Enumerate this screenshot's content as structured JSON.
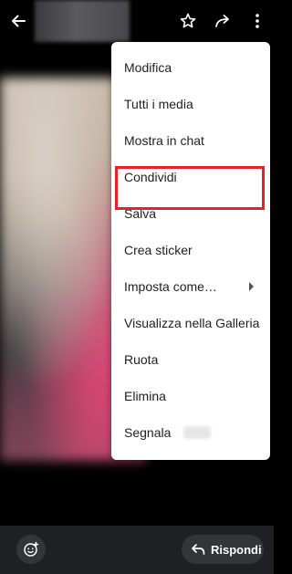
{
  "topbar": {
    "icons": {
      "back": "arrow-left",
      "star": "star-outline",
      "share": "forward-arrow",
      "more": "vertical-dots"
    }
  },
  "menu": {
    "items": [
      {
        "label": "Modifica"
      },
      {
        "label": "Tutti i media"
      },
      {
        "label": "Mostra in chat"
      },
      {
        "label": "Condividi"
      },
      {
        "label": "Salva",
        "highlighted": true
      },
      {
        "label": "Crea sticker"
      },
      {
        "label": "Imposta come…",
        "has_submenu": true
      },
      {
        "label": "Visualizza nella Galleria"
      },
      {
        "label": "Ruota"
      },
      {
        "label": "Elimina"
      },
      {
        "label": "Segnala"
      }
    ],
    "highlight_color": "#e4222b"
  },
  "bottombar": {
    "reply_label": "Rispondi",
    "icons": {
      "emoji": "emoji-add",
      "reply": "reply-arrow"
    }
  }
}
